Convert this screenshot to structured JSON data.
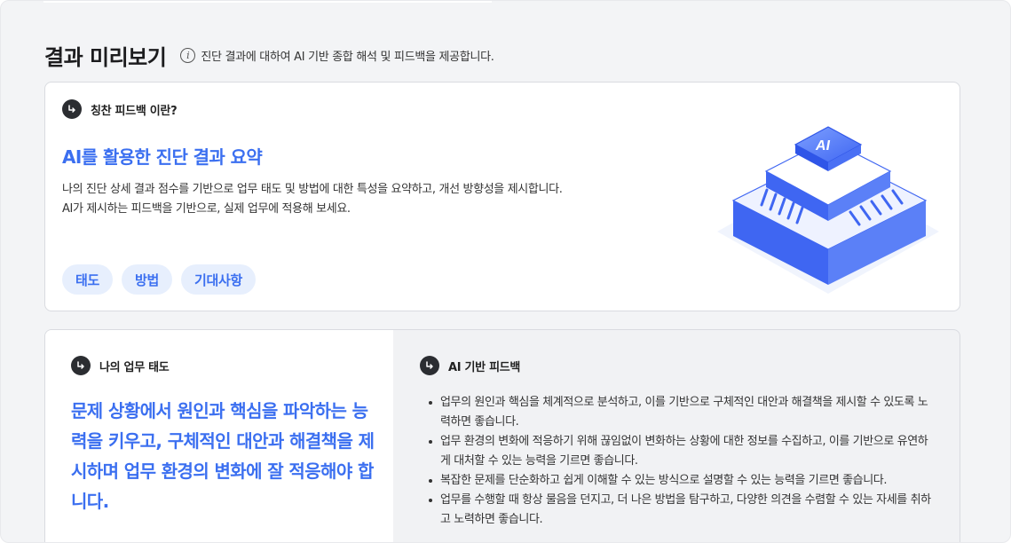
{
  "header": {
    "title": "결과 미리보기",
    "info_icon": "info-circle-icon",
    "description": "진단 결과에 대하여 AI 기반 종합 해석 및 피드백을 제공합니다."
  },
  "intro": {
    "label_icon": "return-arrow-icon",
    "label": "칭찬 피드백 이란?",
    "heading": "AI를 활용한 진단 결과 요약",
    "body_line1": "나의 진단 상세 결과 점수를 기반으로 업무 태도 및 방법에 대한 특성을 요약하고, 개선 방향성을 제시합니다.",
    "body_line2": "AI가 제시하는 피드백을 기반으로, 실제 업무에 적용해 보세요.",
    "chips": [
      "태도",
      "방법",
      "기대사항"
    ],
    "illustration_text": "AI",
    "illustration_icon": "ai-chip-illustration"
  },
  "result": {
    "left_label": "나의 업무 태도",
    "attitude_summary": "문제 상황에서 원인과 핵심을 파악하는 능력을 키우고, 구체적인 대안과 해결책을 제시하며 업무 환경의 변화에 잘 적응해야 합니다.",
    "right_label": "AI 기반 피드백",
    "feedback_items": [
      "업무의 원인과 핵심을 체계적으로 분석하고, 이를 기반으로 구체적인 대안과 해결책을 제시할 수 있도록 노력하면 좋습니다.",
      "업무 환경의 변화에 적응하기 위해 끊임없이 변화하는 상황에 대한 정보를 수집하고, 이를 기반으로 유연하게 대처할 수 있는 능력을 기르면 좋습니다.",
      "복잡한 문제를 단순화하고 쉽게 이해할 수 있는 방식으로 설명할 수 있는 능력을 기르면 좋습니다.",
      "업무를 수행할 때 항상 물음을 던지고, 더 나은 방법을 탐구하고, 다양한 의견을 수렴할 수 있는 자세를 취하고 노력하면 좋습니다."
    ]
  },
  "colors": {
    "accent": "#3b6ff0",
    "chip_bg": "#e7effd",
    "page_bg": "#f3f4f6",
    "icon_bg": "#2b2d31"
  }
}
